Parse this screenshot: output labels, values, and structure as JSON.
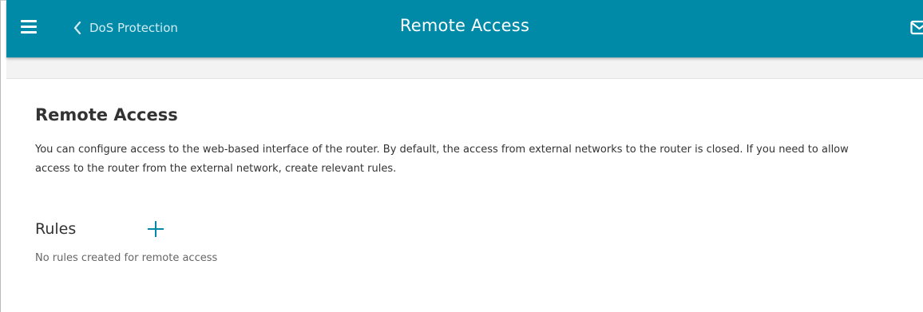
{
  "header": {
    "title": "Remote Access",
    "back_label": "DoS Protection",
    "background": "#008aa8"
  },
  "icons": {
    "menu": "hamburger-menu-icon",
    "back": "chevron-left-icon",
    "messages": "mail-icon",
    "add": "plus-icon"
  },
  "main": {
    "section_title": "Remote Access",
    "description": "You can configure access to the web-based interface of the router. By default, the access from external networks to the router is closed. If you need to allow access to the router from the external network, create relevant rules.",
    "rules": {
      "title": "Rules",
      "empty_text": "No rules created for remote access"
    }
  },
  "colors": {
    "accent": "#008aa8",
    "text": "#333333",
    "muted_text": "#666666"
  }
}
